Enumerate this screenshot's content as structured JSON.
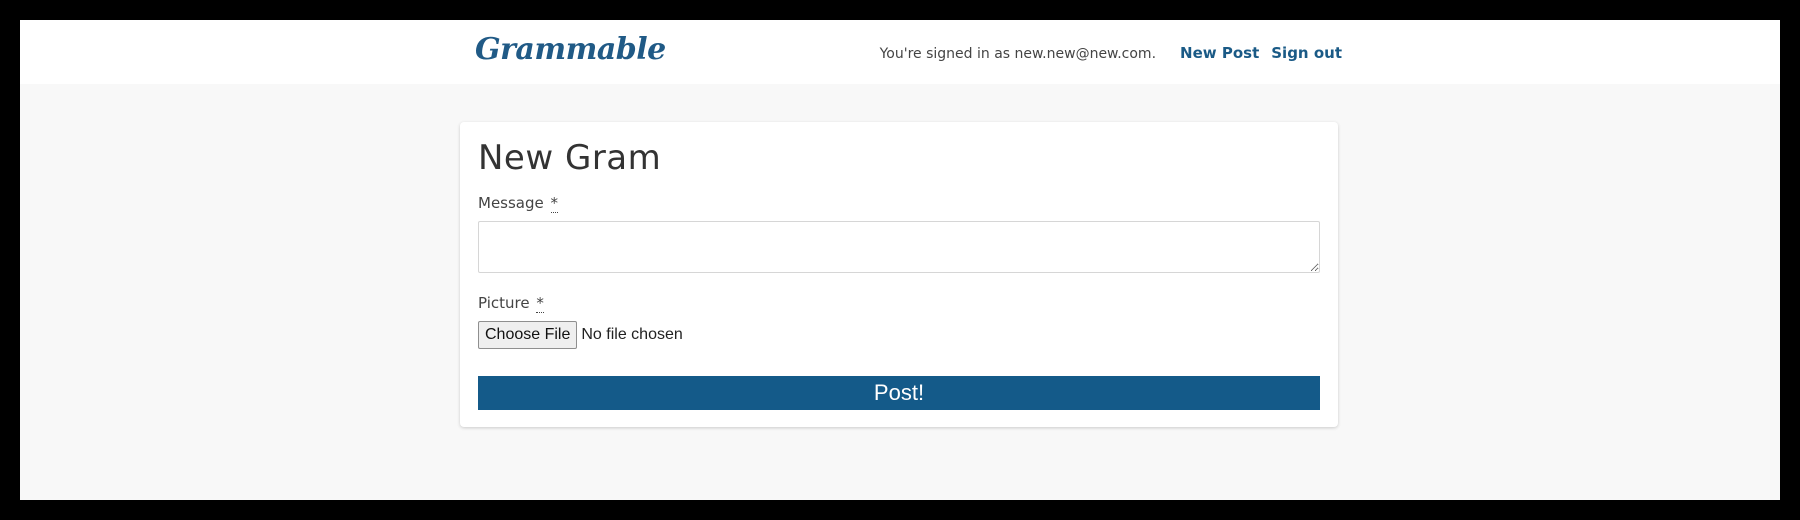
{
  "navbar": {
    "brand": "Grammable",
    "signed_in_text": "You're signed in as new.new@new.com.",
    "new_post_label": "New Post",
    "sign_out_label": "Sign out"
  },
  "form": {
    "title": "New Gram",
    "message_label": "Message",
    "message_required_marker": "*",
    "message_value": "",
    "picture_label": "Picture",
    "picture_required_marker": "*",
    "file_button_label": "Choose File",
    "file_status": "No file chosen",
    "submit_label": "Post!"
  },
  "colors": {
    "brand": "#205a86",
    "link": "#1a5a86",
    "submit_background": "#145a89",
    "page_background": "#f8f8f8"
  }
}
